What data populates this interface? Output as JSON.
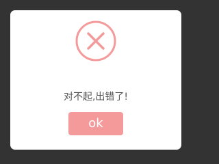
{
  "dialog": {
    "icon": "error-x-icon",
    "message": "对不起,出错了!",
    "ok_label": "ok"
  },
  "colors": {
    "backdrop": "#333333",
    "dialog_bg": "#ffffff",
    "accent": "#f59a9a",
    "message_text": "#555555",
    "button_text": "#ffffff"
  }
}
